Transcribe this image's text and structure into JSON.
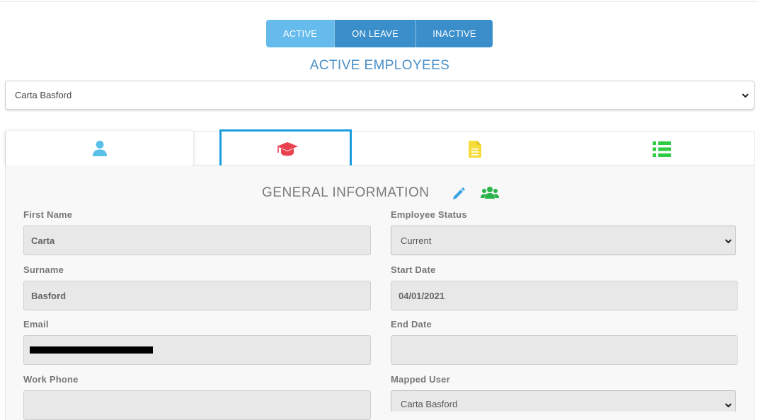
{
  "status_tabs": [
    {
      "label": "ACTIVE",
      "active": true
    },
    {
      "label": "ON LEAVE",
      "active": false
    },
    {
      "label": "INACTIVE",
      "active": false
    }
  ],
  "section_title": "ACTIVE EMPLOYEES",
  "employee_select": {
    "value": "Carta Basford"
  },
  "detail_tabs": [
    {
      "icon": "user-icon",
      "color": "#5bc0e8",
      "selected": true
    },
    {
      "icon": "graduation-cap-icon",
      "color": "#e8424f",
      "highlighted": true
    },
    {
      "icon": "document-icon",
      "color": "#f5dc3a"
    },
    {
      "icon": "list-icon",
      "color": "#2ecc40"
    }
  ],
  "general_info": {
    "title": "GENERAL INFORMATION",
    "edit_icon": "pencil-icon",
    "edit_icon_color": "#3aa3e3",
    "group_icon": "users-icon",
    "group_icon_color": "#2bb34a"
  },
  "fields": {
    "first_name": {
      "label": "First Name",
      "value": "Carta"
    },
    "surname": {
      "label": "Surname",
      "value": "Basford"
    },
    "email": {
      "label": "Email",
      "value": ""
    },
    "work_phone": {
      "label": "Work Phone",
      "value": ""
    },
    "employee_status": {
      "label": "Employee Status",
      "value": "Current"
    },
    "start_date": {
      "label": "Start Date",
      "value": "04/01/2021"
    },
    "end_date": {
      "label": "End Date",
      "value": ""
    },
    "mapped_user": {
      "label": "Mapped User",
      "value": "Carta Basford"
    }
  },
  "colors": {
    "accent_blue": "#3a8fcb",
    "active_tab": "#65bcec",
    "title_blue": "#4a8fc8",
    "highlight_border": "#1b9cdf"
  }
}
